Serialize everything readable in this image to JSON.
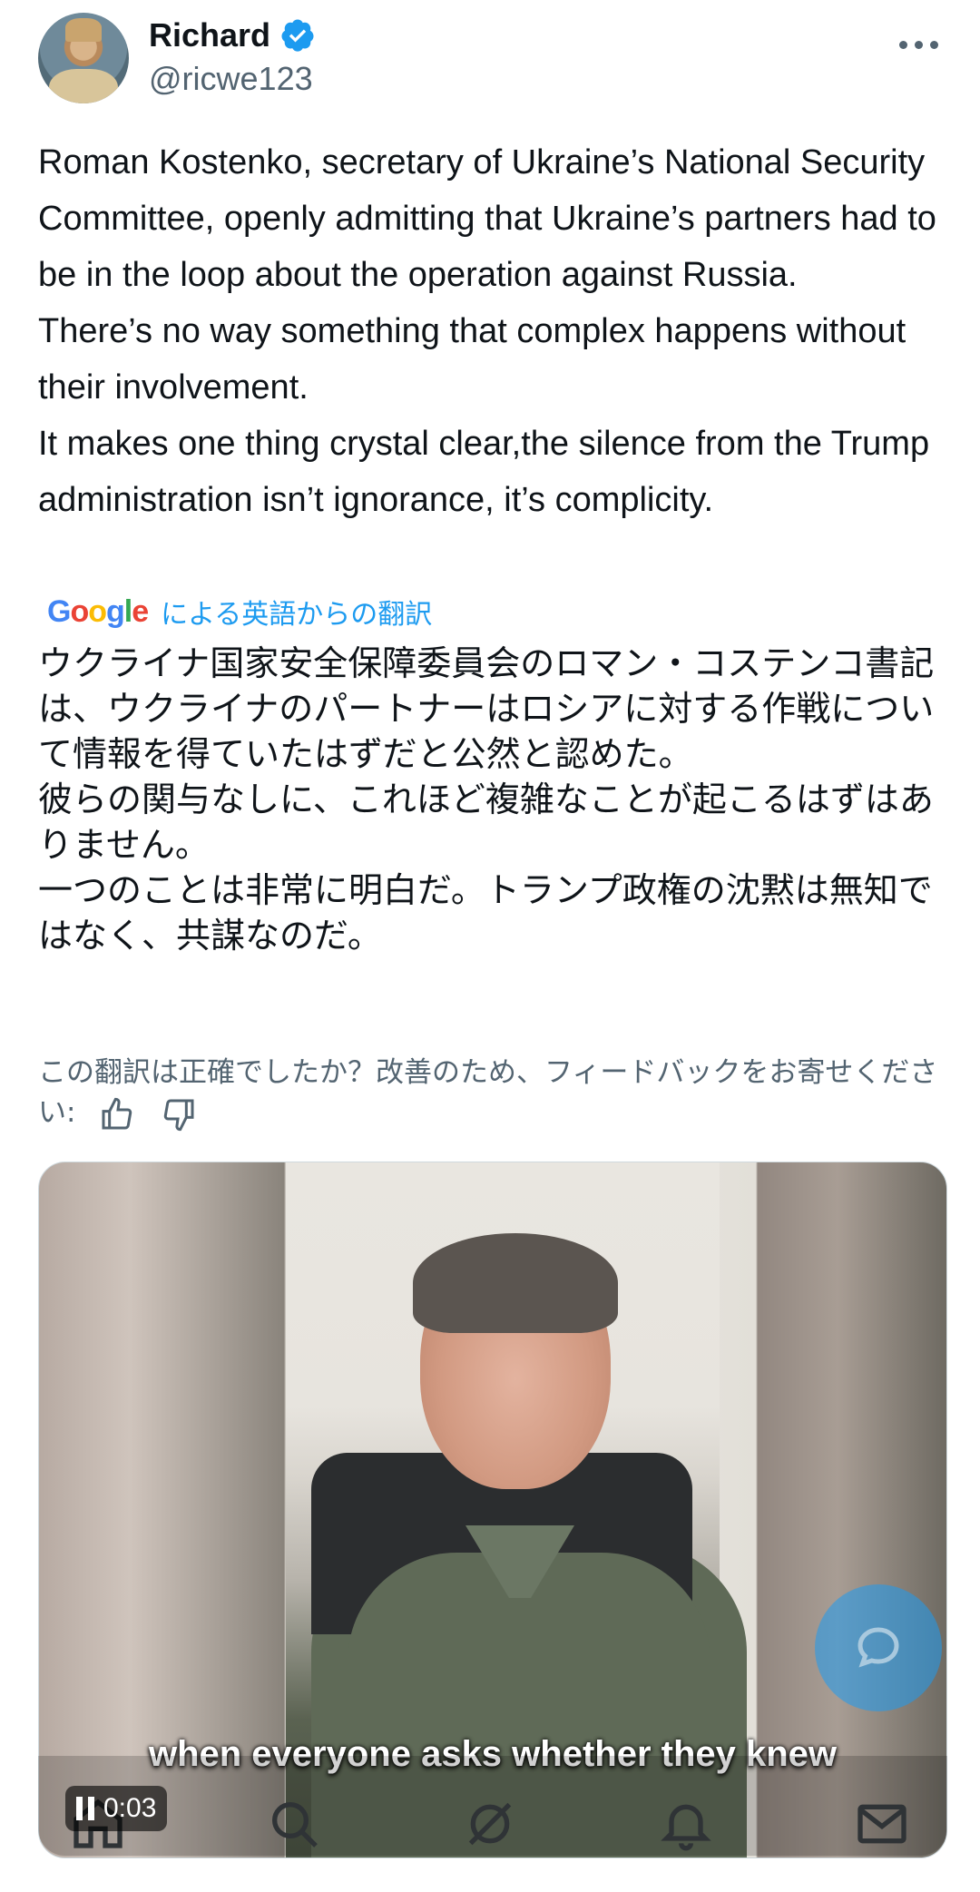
{
  "author": {
    "name": "Richard",
    "handle": "@ricwe123",
    "verified": true,
    "avatar_icon": "avatar-portrait"
  },
  "post": {
    "paragraphs": [
      "Roman Kostenko, secretary of Ukraine’s National Security Committee, openly admitting that Ukraine’s partners had to be in the loop about the operation against Russia.",
      "There’s no way something that complex happens without their involvement.",
      "It makes one thing crystal clear,the silence from the Trump administration isn’t ignorance, it’s complicity."
    ]
  },
  "translation": {
    "provider_label": "による英語からの翻訳",
    "paragraphs": [
      "ウクライナ国家安全保障委員会のロマン・コステンコ書記は、ウクライナのパートナーはロシアに対する作戦について情報を得ていたはずだと公然と認めた。",
      "彼らの関与なしに、これほど複雑なことが起こるはずはありません。",
      "一つのことは非常に明白だ。トランプ政権の沈黙は無知ではなく、共謀なのだ。"
    ],
    "feedback_prompt": "この翻訳は正確でしたか？改善のため、フィードバックをお寄せください:"
  },
  "video": {
    "subtitle": "when everyone asks whether they knew",
    "time": "0:03"
  },
  "colors": {
    "accent": "#1d9bf0",
    "text": "#0f1419",
    "muted": "#536471"
  }
}
